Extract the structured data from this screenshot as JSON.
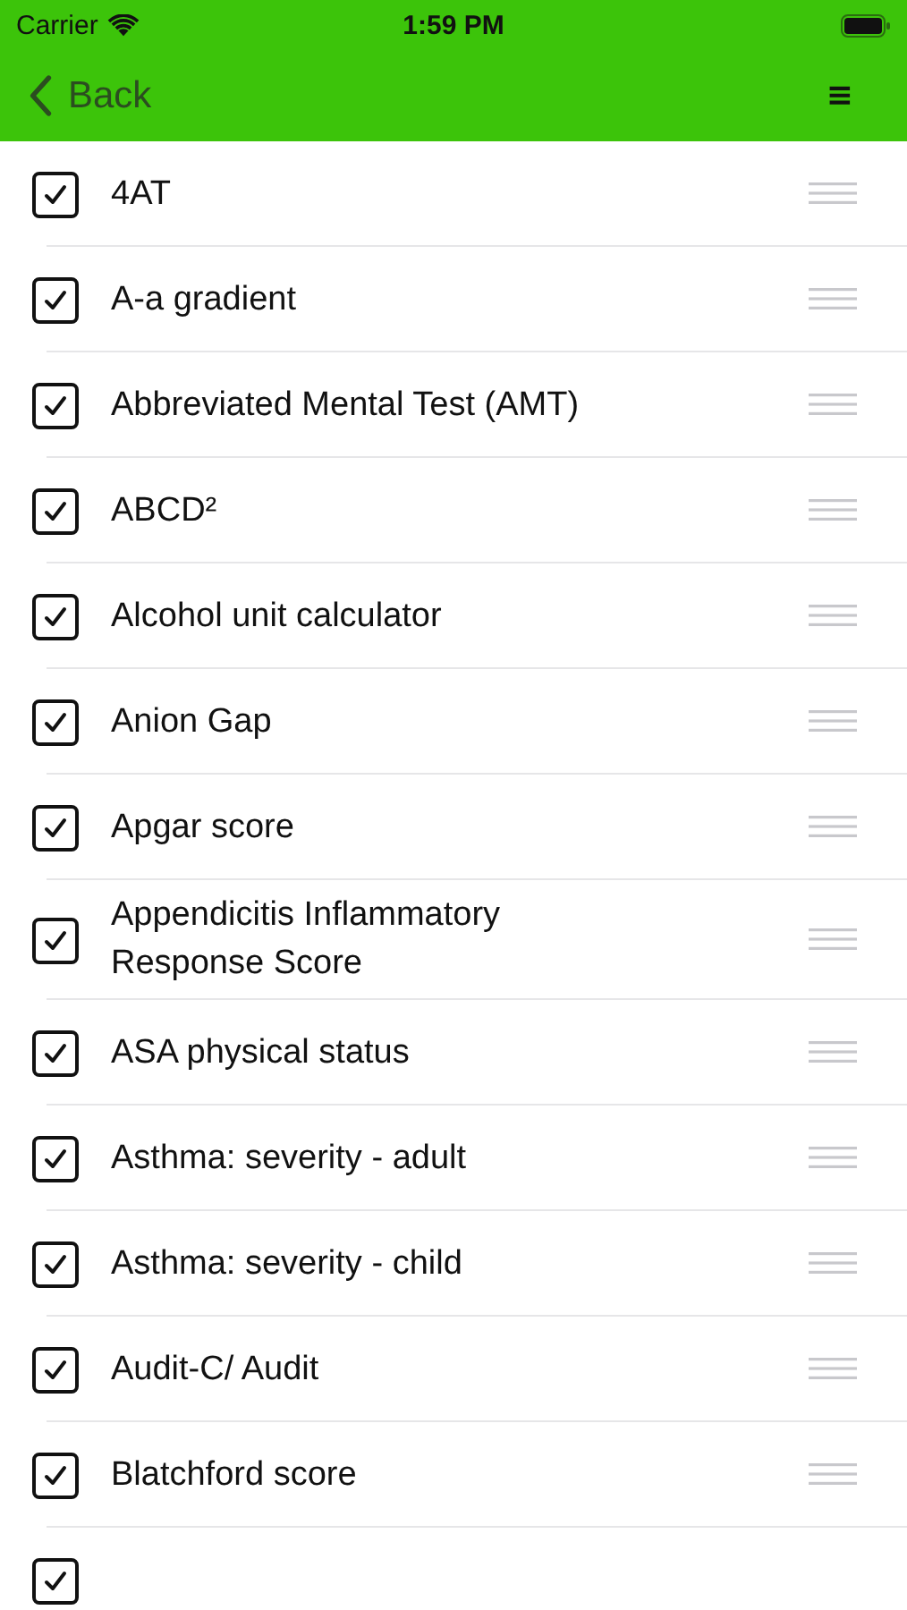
{
  "status_bar": {
    "carrier": "Carrier",
    "time": "1:59 PM"
  },
  "nav": {
    "back": "Back",
    "menu": "≡"
  },
  "items": [
    {
      "label": "4AT",
      "checked": true
    },
    {
      "label": "A-a gradient",
      "checked": true
    },
    {
      "label": "Abbreviated Mental Test (AMT)",
      "checked": true
    },
    {
      "label": "ABCD²",
      "checked": true
    },
    {
      "label": "Alcohol unit calculator",
      "checked": true
    },
    {
      "label": "Anion Gap",
      "checked": true
    },
    {
      "label": "Apgar score",
      "checked": true
    },
    {
      "label": "Appendicitis Inflammatory Response Score",
      "checked": true
    },
    {
      "label": "ASA physical status",
      "checked": true
    },
    {
      "label": "Asthma: severity - adult",
      "checked": true
    },
    {
      "label": "Asthma: severity - child",
      "checked": true
    },
    {
      "label": "Audit-C/ Audit",
      "checked": true
    },
    {
      "label": "Blatchford score",
      "checked": true
    },
    {
      "checked": true
    }
  ]
}
